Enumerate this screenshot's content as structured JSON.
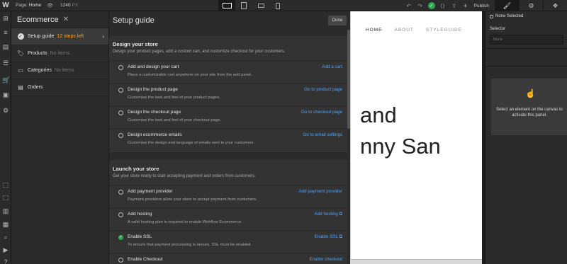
{
  "topbar": {
    "logo": "W",
    "page_label": "Page:",
    "page_name": "Home",
    "width_value": "1240",
    "width_unit": "PX",
    "publish_label": "Publish"
  },
  "ecommerce": {
    "title": "Ecommerce",
    "items": [
      {
        "label": "Setup guide",
        "note": "12 steps left"
      },
      {
        "label": "Products",
        "note": "No items"
      },
      {
        "label": "Categories",
        "note": "No items"
      },
      {
        "label": "Orders",
        "note": ""
      }
    ]
  },
  "setup": {
    "title": "Setup guide",
    "done_label": "Done",
    "design": {
      "title": "Design your store",
      "subtitle": "Design your product pages, add a custom cart, and customize checkout for your customers.",
      "rows": [
        {
          "title": "Add and design your cart",
          "desc": "Place a customizable cart anywhere on your site from the add panel.",
          "link": "Add a cart"
        },
        {
          "title": "Design the product page",
          "desc": "Customize the look and feel of your product pages.",
          "link": "Go to product page"
        },
        {
          "title": "Design the checkout page",
          "desc": "Customize the look and feel of your checkout page.",
          "link": "Go to checkout page"
        },
        {
          "title": "Design ecommerce emails",
          "desc": "Customize the design and language of emails sent to your customers.",
          "link": "Go to email settings"
        }
      ]
    },
    "launch": {
      "title": "Launch your store",
      "subtitle": "Get your store ready to start accepting payment and orders from customers.",
      "rows": [
        {
          "title": "Add payment provider",
          "desc": "Payment providers allow your store to accept payment from customers.",
          "link": "Add payment provider"
        },
        {
          "title": "Add hosting",
          "desc": "A valid hosting plan is required to enable Webflow Ecommerce.",
          "link": "Add hosting ⧉"
        },
        {
          "title": "Enable SSL",
          "desc": "To ensure that payment processing is secure, SSL must be enabled.",
          "link": "Enable SSL ⧉"
        },
        {
          "title": "Enable Checkout",
          "desc": "",
          "link": "Enable checkout"
        }
      ]
    }
  },
  "canvas": {
    "nav": [
      "HOME",
      "ABOUT",
      "STYLEGUIDE"
    ],
    "hero_line1": "and",
    "hero_line2": "nny San"
  },
  "right_panel": {
    "none_selected": "None Selected",
    "selector_label": "Selector",
    "selector_placeholder": "None",
    "hint": "Select an element on the canvas to activate this panel."
  }
}
